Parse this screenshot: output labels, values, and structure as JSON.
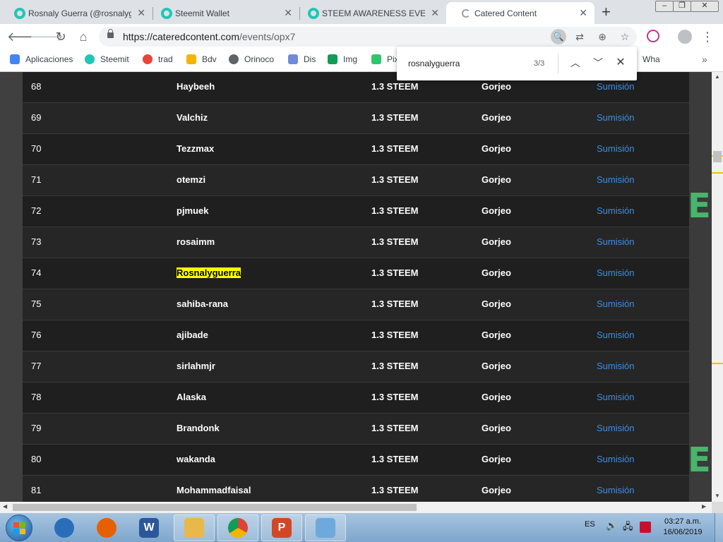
{
  "browser": {
    "tabs": [
      {
        "title": "Rosnaly Guerra (@rosnalyguerra)",
        "active": false
      },
      {
        "title": "Steemit Wallet",
        "active": false
      },
      {
        "title": "STEEM AWARENESS EVENT",
        "active": false
      },
      {
        "title": "Catered Content",
        "active": true
      }
    ],
    "new_tab_label": "+",
    "window_controls": {
      "minimize": "–",
      "maximize": "❐",
      "close": "✕"
    },
    "url_host": "https://cateredcontent.com",
    "url_path": "/events/opx7",
    "bookmarks": [
      {
        "label": "Aplicaciones",
        "icon": "apps-grid-icon",
        "color": "#4285f4"
      },
      {
        "label": "Steemit",
        "icon": "steemit-icon",
        "color": "#1fc7b6"
      },
      {
        "label": "trad",
        "icon": "google-icon",
        "color": "#ea4335"
      },
      {
        "label": "Bdv",
        "icon": "bdv-icon",
        "color": "#f4b400"
      },
      {
        "label": "Orinoco",
        "icon": "globe-icon",
        "color": "#5f6368"
      },
      {
        "label": "Dis",
        "icon": "discord-icon",
        "color": "#7289da"
      },
      {
        "label": "Img",
        "icon": "image-icon",
        "color": "#0f9d58"
      },
      {
        "label": "Pix",
        "icon": "pixabay-icon",
        "color": "#2ec66d"
      },
      {
        "label": "Wha",
        "icon": "whatsapp-icon",
        "color": "#25d366"
      }
    ],
    "more_bookmarks": "»"
  },
  "find_bar": {
    "query": "rosnalyguerra",
    "count": "3/3"
  },
  "table": {
    "rows": [
      {
        "num": "68",
        "user": "Haybeeh",
        "amount": "1.3 STEEM",
        "type": "Gorjeo",
        "link": "Sumisión"
      },
      {
        "num": "69",
        "user": "Valchiz",
        "amount": "1.3 STEEM",
        "type": "Gorjeo",
        "link": "Sumisión"
      },
      {
        "num": "70",
        "user": "Tezzmax",
        "amount": "1.3 STEEM",
        "type": "Gorjeo",
        "link": "Sumisión"
      },
      {
        "num": "71",
        "user": "otemzi",
        "amount": "1.3 STEEM",
        "type": "Gorjeo",
        "link": "Sumisión"
      },
      {
        "num": "72",
        "user": "pjmuek",
        "amount": "1.3 STEEM",
        "type": "Gorjeo",
        "link": "Sumisión"
      },
      {
        "num": "73",
        "user": "rosaimm",
        "amount": "1.3 STEEM",
        "type": "Gorjeo",
        "link": "Sumisión"
      },
      {
        "num": "74",
        "user": "Rosnalyguerra",
        "amount": "1.3 STEEM",
        "type": "Gorjeo",
        "link": "Sumisión",
        "highlight": true
      },
      {
        "num": "75",
        "user": "sahiba-rana",
        "amount": "1.3 STEEM",
        "type": "Gorjeo",
        "link": "Sumisión"
      },
      {
        "num": "76",
        "user": "ajibade",
        "amount": "1.3 STEEM",
        "type": "Gorjeo",
        "link": "Sumisión"
      },
      {
        "num": "77",
        "user": "sirlahmjr",
        "amount": "1.3 STEEM",
        "type": "Gorjeo",
        "link": "Sumisión"
      },
      {
        "num": "78",
        "user": "Alaska",
        "amount": "1.3 STEEM",
        "type": "Gorjeo",
        "link": "Sumisión"
      },
      {
        "num": "79",
        "user": "Brandonk",
        "amount": "1.3 STEEM",
        "type": "Gorjeo",
        "link": "Sumisión"
      },
      {
        "num": "80",
        "user": "wakanda",
        "amount": "1.3 STEEM",
        "type": "Gorjeo",
        "link": "Sumisión"
      },
      {
        "num": "81",
        "user": "Mohammadfaisal",
        "amount": "1.3 STEEM",
        "type": "Gorjeo",
        "link": "Sumisión"
      }
    ],
    "side_letter": "E",
    "link_color": "#3b8fe6",
    "highlight_color": "#ffff00"
  },
  "taskbar": {
    "apps": [
      {
        "name": "google-earth-icon",
        "color": "#2a6ebb"
      },
      {
        "name": "firefox-icon",
        "color": "#e66000"
      },
      {
        "name": "word-icon",
        "color": "#2b579a",
        "label": "W"
      },
      {
        "name": "explorer-icon",
        "color": "#e8b84a"
      },
      {
        "name": "chrome-icon",
        "color": "#db4437"
      },
      {
        "name": "powerpoint-icon",
        "color": "#d24726",
        "label": "P"
      },
      {
        "name": "notepad-icon",
        "color": "#6fa8dc"
      }
    ],
    "language": "ES",
    "time": "03:27 a.m.",
    "date": "16/06/2019"
  }
}
